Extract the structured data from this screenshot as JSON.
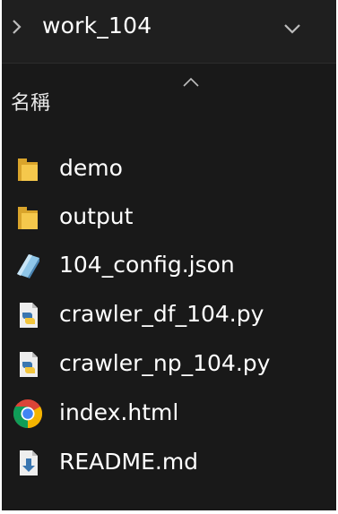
{
  "header": {
    "folder_name": "work_104"
  },
  "columns": {
    "name_label": "名稱"
  },
  "files": [
    {
      "name": "demo",
      "icon": "folder-icon"
    },
    {
      "name": "output",
      "icon": "folder-icon"
    },
    {
      "name": "104_config.json",
      "icon": "json-file-icon"
    },
    {
      "name": "crawler_df_104.py",
      "icon": "python-file-icon"
    },
    {
      "name": "crawler_np_104.py",
      "icon": "python-file-icon"
    },
    {
      "name": "index.html",
      "icon": "chrome-icon"
    },
    {
      "name": "README.md",
      "icon": "markdown-file-icon"
    }
  ],
  "colors": {
    "background": "#191919",
    "header": "#1f1f1f",
    "folder": "#f2c14a",
    "text": "#ffffff"
  }
}
